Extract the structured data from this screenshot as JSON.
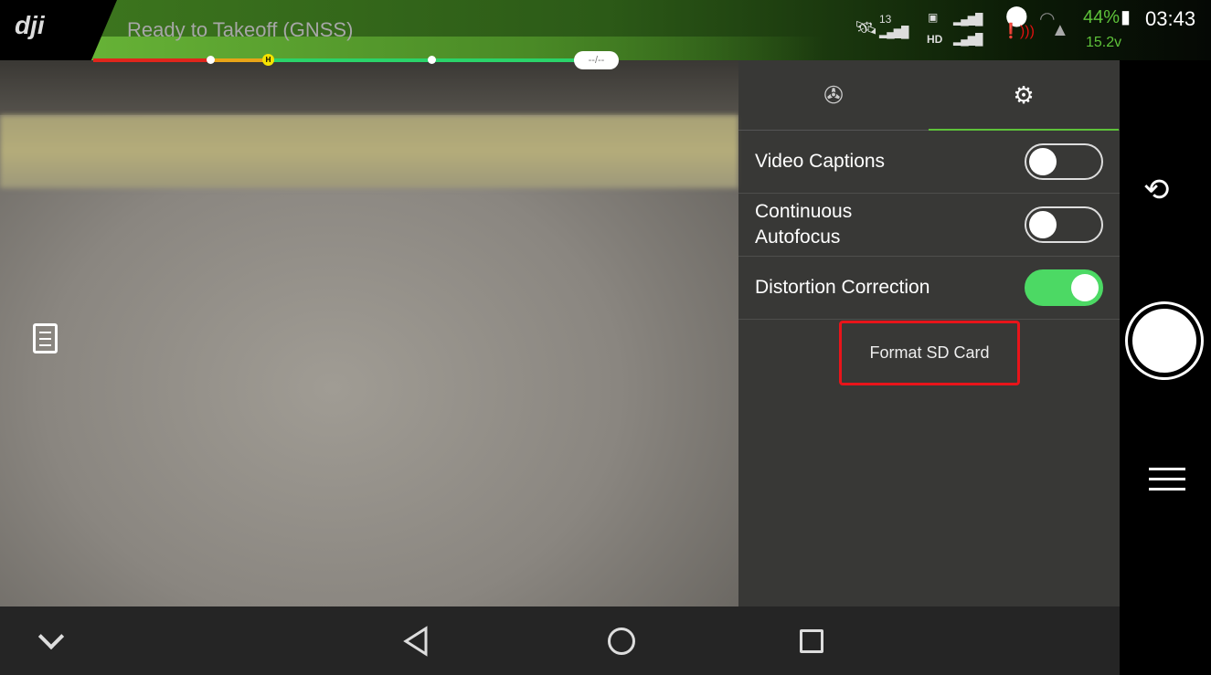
{
  "app": {
    "logo": "dji"
  },
  "topbar": {
    "status": "Ready to Takeoff (GNSS)",
    "altitude_pill": "--/--",
    "home_marker": "H",
    "gps_count": "13",
    "hd_label": "HD",
    "battery_percent": "44%",
    "voltage": "15.2v",
    "time": "03:43"
  },
  "colors": {
    "accent": "#5ec23a",
    "toggle_on": "#4cd964",
    "highlight": "#e8141a"
  },
  "panel": {
    "tabs": [
      {
        "icon": "aperture-icon"
      },
      {
        "icon": "gear-icon",
        "active": true
      }
    ],
    "settings": [
      {
        "label": "Video Captions",
        "enabled": false
      },
      {
        "label": "Continuous Autofocus",
        "enabled": false
      },
      {
        "label": "Distortion Correction",
        "enabled": true
      }
    ],
    "format_button": "Format SD Card"
  },
  "left": {
    "icon": "document-icon"
  },
  "right": {
    "icons": [
      "camera-switch-icon",
      "shutter-button",
      "camera-settings-icon"
    ]
  },
  "navbar": {
    "icons": [
      "chevron-down-icon",
      "back-icon",
      "home-icon",
      "recents-icon"
    ]
  }
}
